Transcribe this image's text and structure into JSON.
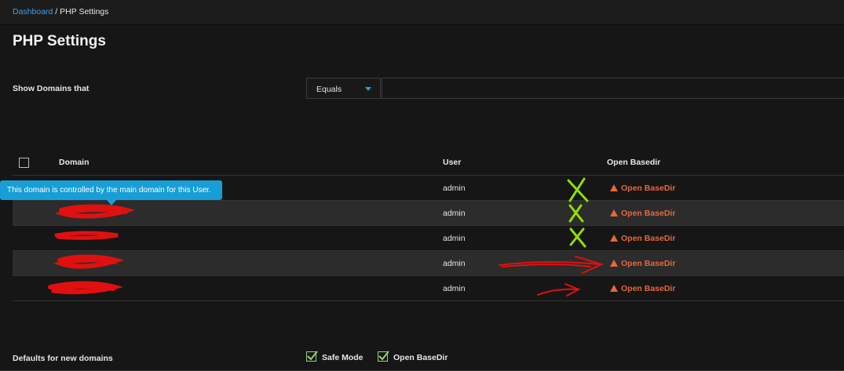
{
  "breadcrumb": {
    "home": "Dashboard",
    "separator": " / ",
    "current": "PHP Settings"
  },
  "page_title": "PHP Settings",
  "filter": {
    "label": "Show Domains that",
    "operator": "Equals",
    "value": ""
  },
  "table": {
    "columns": {
      "domain": "Domain",
      "user": "User",
      "open_basedir": "Open Basedir"
    },
    "rows": [
      {
        "user": "admin",
        "open_basedir": "Open BaseDir"
      },
      {
        "user": "admin",
        "open_basedir": "Open BaseDir"
      },
      {
        "user": "admin",
        "open_basedir": "Open BaseDir"
      },
      {
        "user": "admin",
        "open_basedir": "Open BaseDir"
      },
      {
        "user": "admin",
        "open_basedir": "Open BaseDir"
      }
    ]
  },
  "tooltip": "This domain is controlled by the main domain for this User.",
  "defaults": {
    "label": "Defaults for new domains",
    "safe_mode": {
      "label": "Safe Mode",
      "checked": true
    },
    "open_basedir": {
      "label": "Open BaseDir",
      "checked": true
    }
  },
  "colors": {
    "link": "#3aa0e8",
    "warning": "#e8663c",
    "tooltip": "#179ed6",
    "annotation_red": "#e01010",
    "annotation_green": "#8fe000"
  }
}
